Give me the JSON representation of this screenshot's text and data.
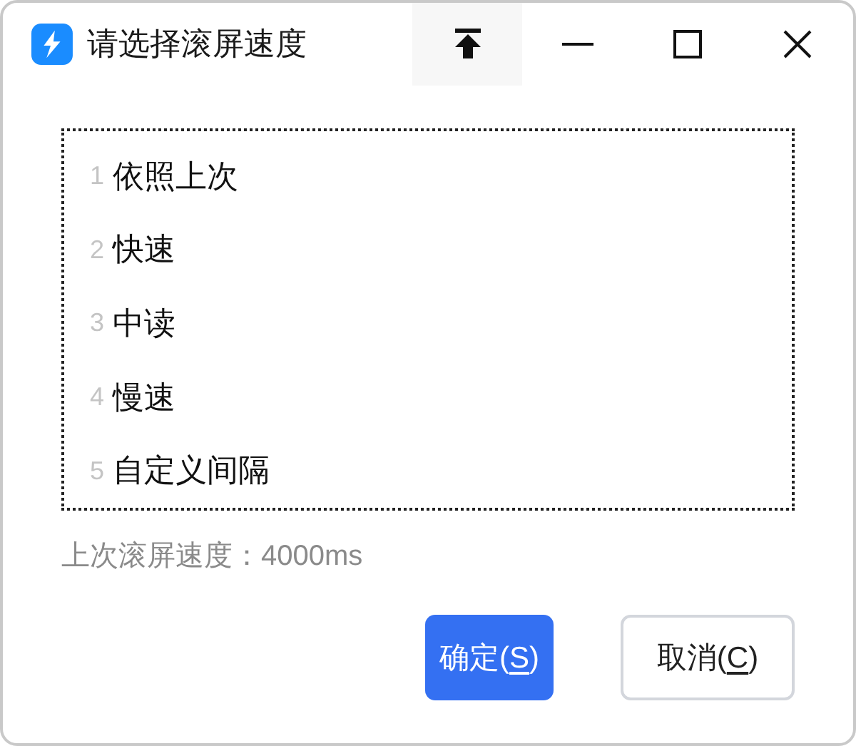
{
  "window": {
    "title": "请选择滚屏速度"
  },
  "options": [
    {
      "number": "1",
      "label": "依照上次"
    },
    {
      "number": "2",
      "label": "快速"
    },
    {
      "number": "3",
      "label": "中读"
    },
    {
      "number": "4",
      "label": "慢速"
    },
    {
      "number": "5",
      "label": "自定义间隔"
    }
  ],
  "status": "上次滚屏速度：4000ms",
  "buttons": [
    {
      "kind": "primary",
      "label_before": "确定(",
      "access_key": "S",
      "label_after": ")"
    },
    {
      "kind": "secondary",
      "label_before": "取消(",
      "access_key": "C",
      "label_after": ")"
    }
  ]
}
